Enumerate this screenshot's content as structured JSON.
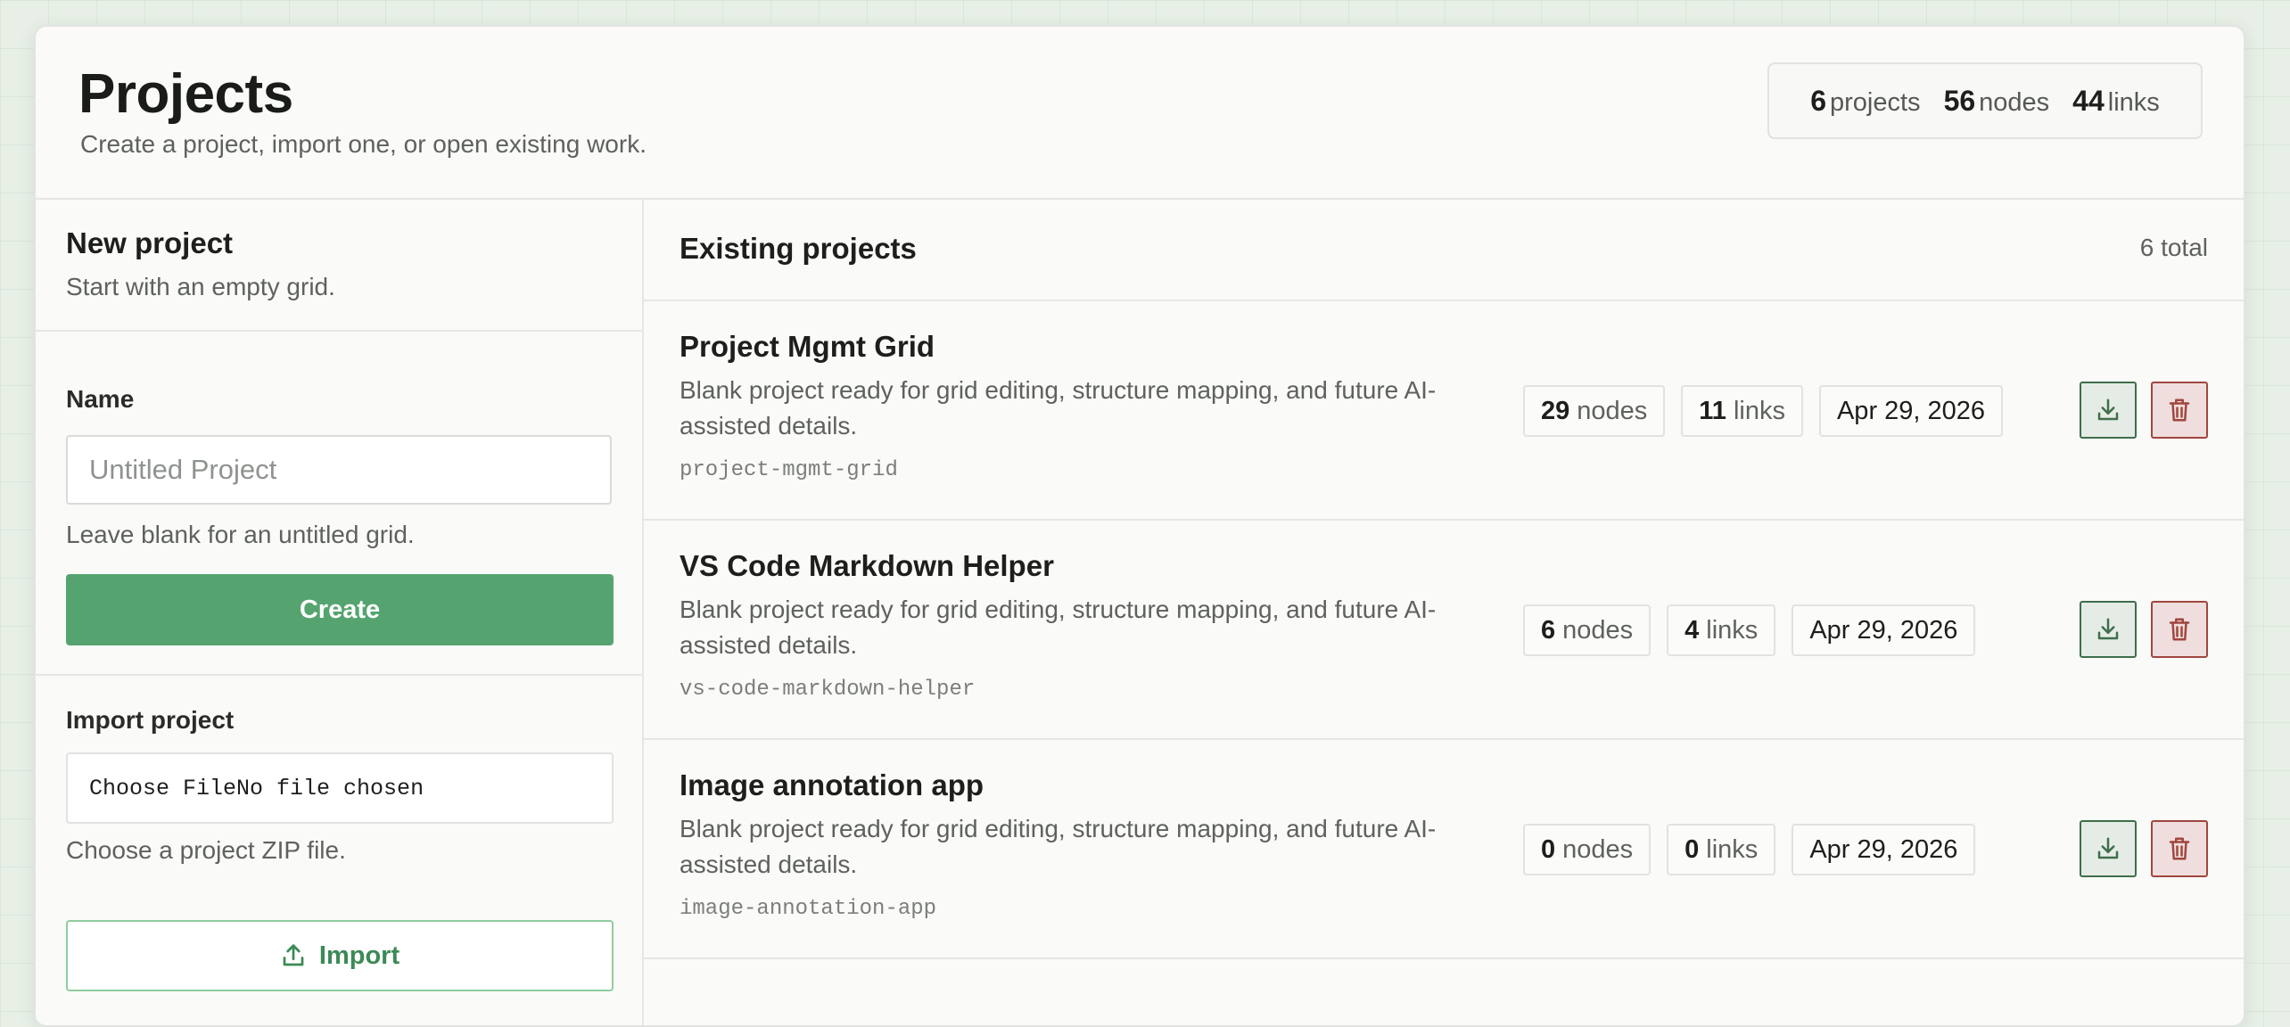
{
  "header": {
    "title": "Projects",
    "subtitle": "Create a project, import one, or open existing work.",
    "stats": {
      "projects_count": "6",
      "projects_label": "projects",
      "nodes_count": "56",
      "nodes_label": "nodes",
      "links_count": "44",
      "links_label": "links"
    }
  },
  "new_project": {
    "title": "New project",
    "subtitle": "Start with an empty grid.",
    "name_label": "Name",
    "name_placeholder": "Untitled Project",
    "name_hint": "Leave blank for an untitled grid.",
    "create_label": "Create"
  },
  "import_project": {
    "title": "Import project",
    "file_button_label": "Choose File",
    "file_status": "No file chosen",
    "hint": "Choose a project ZIP file.",
    "import_label": "Import"
  },
  "existing": {
    "title": "Existing projects",
    "total": "6 total",
    "projects": [
      {
        "name": "Project Mgmt Grid",
        "description": "Blank project ready for grid editing, structure mapping, and future AI-assisted details.",
        "slug": "project-mgmt-grid",
        "nodes": "29",
        "nodes_label": "nodes",
        "links": "11",
        "links_label": "links",
        "date": "Apr 29, 2026"
      },
      {
        "name": "VS Code Markdown Helper",
        "description": "Blank project ready for grid editing, structure mapping, and future AI-assisted details.",
        "slug": "vs-code-markdown-helper",
        "nodes": "6",
        "nodes_label": "nodes",
        "links": "4",
        "links_label": "links",
        "date": "Apr 29, 2026"
      },
      {
        "name": "Image annotation app",
        "description": "Blank project ready for grid editing, structure mapping, and future AI-assisted details.",
        "slug": "image-annotation-app",
        "nodes": "0",
        "nodes_label": "nodes",
        "links": "0",
        "links_label": "links",
        "date": "Apr 29, 2026"
      }
    ]
  },
  "icons": {
    "download": "download-icon",
    "delete": "trash-icon",
    "upload": "upload-icon"
  },
  "colors": {
    "accent_green": "#55a46f",
    "download_border": "#3f6e4c",
    "delete_border": "#a0473f"
  }
}
